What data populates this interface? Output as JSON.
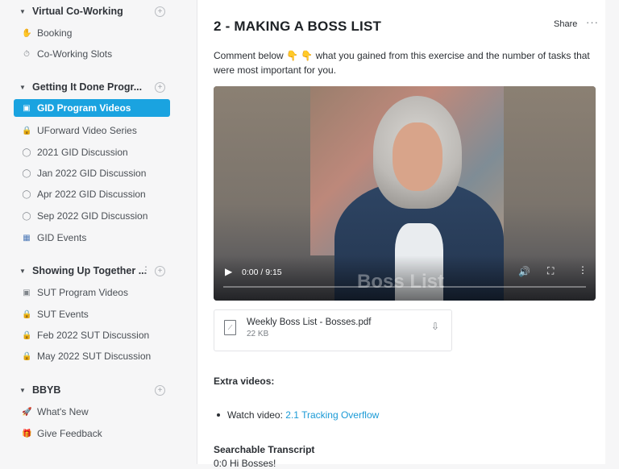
{
  "sidebar": {
    "groups": [
      {
        "title": "Virtual Co-Working",
        "items": [
          {
            "label": "Booking",
            "icon": "hand-wave-icon"
          },
          {
            "label": "Co-Working Slots",
            "icon": "stopwatch-icon"
          }
        ]
      },
      {
        "title": "Getting It Done Progr...",
        "items": [
          {
            "label": "GID Program Videos",
            "icon": "video-icon",
            "active": true
          },
          {
            "label": "UForward Video Series",
            "icon": "lock-icon"
          },
          {
            "label": "2021 GID Discussion",
            "icon": "chat-icon"
          },
          {
            "label": "Jan 2022 GID Discussion",
            "icon": "chat-icon"
          },
          {
            "label": "Apr 2022 GID Discussion",
            "icon": "chat-icon"
          },
          {
            "label": "Sep 2022 GID Discussion",
            "icon": "chat-icon"
          },
          {
            "label": "GID Events",
            "icon": "calendar-icon"
          }
        ]
      },
      {
        "title": "Showing Up Together ...",
        "items": [
          {
            "label": "SUT Program Videos",
            "icon": "video-icon"
          },
          {
            "label": "SUT Events",
            "icon": "lock-icon"
          },
          {
            "label": "Feb 2022 SUT Discussion",
            "icon": "lock-icon"
          },
          {
            "label": "May 2022 SUT Discussion",
            "icon": "lock-icon"
          }
        ]
      },
      {
        "title": "BBYB",
        "items": [
          {
            "label": "What's New",
            "icon": "rocket-icon"
          },
          {
            "label": "Give Feedback",
            "icon": "gift-icon"
          }
        ]
      }
    ]
  },
  "post": {
    "title": "2 - MAKING A BOSS LIST",
    "share_label": "Share",
    "more_label": "···",
    "description": "Comment below 👇 👇 what you gained from this exercise and the number of tasks that were most important for you.",
    "video": {
      "time": "0:00 / 9:15",
      "watermark": "Boss List",
      "progress": 0
    },
    "attachment": {
      "name": "Weekly Boss List - Bosses.pdf",
      "size": "22 KB"
    },
    "extra_heading": "Extra videos:",
    "bullet_prefix": "Watch video: ",
    "bullet_link": "2.1 Tracking Overflow",
    "transcript_heading": "Searchable Transcript",
    "transcript_first": "0:0 Hi Bosses!"
  },
  "colors": {
    "accent": "#1aa3e0",
    "link": "#1a9ad6"
  }
}
